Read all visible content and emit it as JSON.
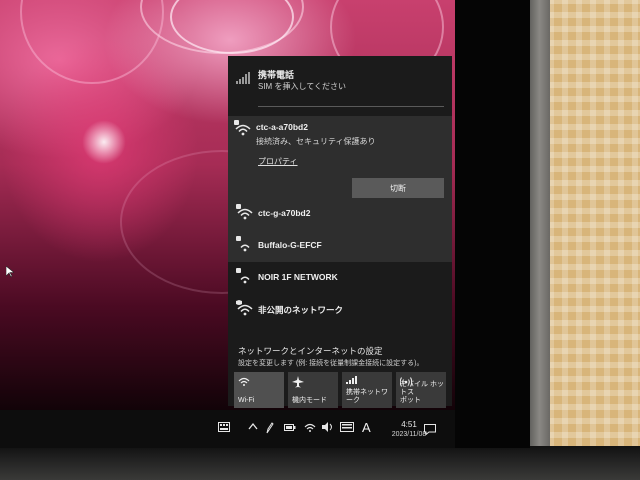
{
  "flyout": {
    "cellular": {
      "title": "携帯電話",
      "subtitle": "SIM を挿入してください"
    },
    "connected_network": {
      "name": "ctc-a-a70bd2",
      "status": "接続済み、セキュリティ保護あり",
      "properties_label": "プロパティ",
      "disconnect_label": "切断"
    },
    "networks": [
      {
        "name": "ctc-g-a70bd2"
      },
      {
        "name": "Buffalo-G-EFCF"
      },
      {
        "name": "NOIR 1F NETWORK"
      },
      {
        "name": "非公開のネットワーク"
      }
    ],
    "settings": {
      "link": "ネットワークとインターネットの設定",
      "description": "設定を変更します (例: 接続を従量制課金接続に設定する)。"
    },
    "quick_actions": [
      {
        "label": "Wi-Fi",
        "icon": "wifi-icon",
        "active": true
      },
      {
        "label": "機内モード",
        "icon": "airplane-icon",
        "active": false
      },
      {
        "label": "携帯ネットワーク",
        "icon": "cellular-icon",
        "active": false
      },
      {
        "label": "モバイル ホットス\nポット",
        "icon": "hotspot-icon",
        "active": false
      }
    ]
  },
  "taskbar": {
    "ime_indicator": "A",
    "time": "4:51",
    "date": "2023/11/08"
  },
  "colors": {
    "flyout_bg": "#1b1b1b",
    "connected_bg": "#2e2e2e",
    "button_bg": "#5a5a5a",
    "wallpaper_accent": "#c8406e"
  }
}
